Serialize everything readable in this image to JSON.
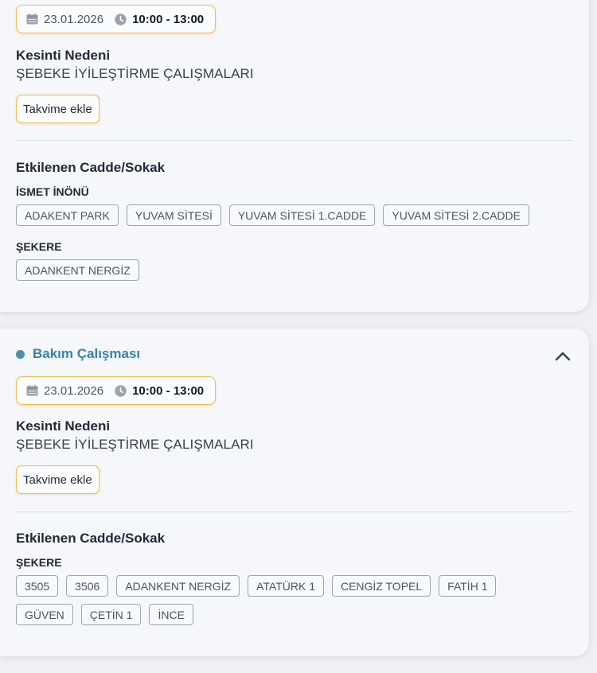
{
  "cards": [
    {
      "date": "23.01.2026",
      "time": "10:00 - 13:00",
      "reason_title": "Kesinti Nedeni",
      "reason": "ŞEBEKE İYİLEŞTİRME ÇALIŞMALARI",
      "calendar_button": "Takvime ekle",
      "affected_title": "Etkilenen Cadde/Sokak",
      "groups": [
        {
          "name": "İSMET İNÖNÜ",
          "streets": [
            "ADAKENT PARK",
            "YUVAM SİTESİ",
            "YUVAM SİTESİ 1.CADDE",
            "YUVAM SİTESİ 2.CADDE"
          ]
        },
        {
          "name": "ŞEKERE",
          "streets": [
            "ADANKENT NERGİZ"
          ]
        }
      ]
    },
    {
      "status": "Bakım Çalışması",
      "status_color": "#3a82a6",
      "date": "23.01.2026",
      "time": "10:00 - 13:00",
      "reason_title": "Kesinti Nedeni",
      "reason": "ŞEBEKE İYİLEŞTİRME ÇALIŞMALARI",
      "calendar_button": "Takvime ekle",
      "affected_title": "Etkilenen Cadde/Sokak",
      "groups": [
        {
          "name": "ŞEKERE",
          "streets": [
            "3505",
            "3506",
            "ADANKENT NERGİZ",
            "ATATÜRK 1",
            "CENGİZ TOPEL",
            "FATİH 1",
            "GÜVEN",
            "ÇETİN 1",
            "İNCE"
          ]
        }
      ]
    }
  ],
  "icons": {
    "date": "calendar-icon",
    "time": "clock-icon",
    "collapse": "chevron-up-icon"
  },
  "colors": {
    "accent_border": "#f2b94b",
    "status_dot": "#4b8fb0"
  }
}
